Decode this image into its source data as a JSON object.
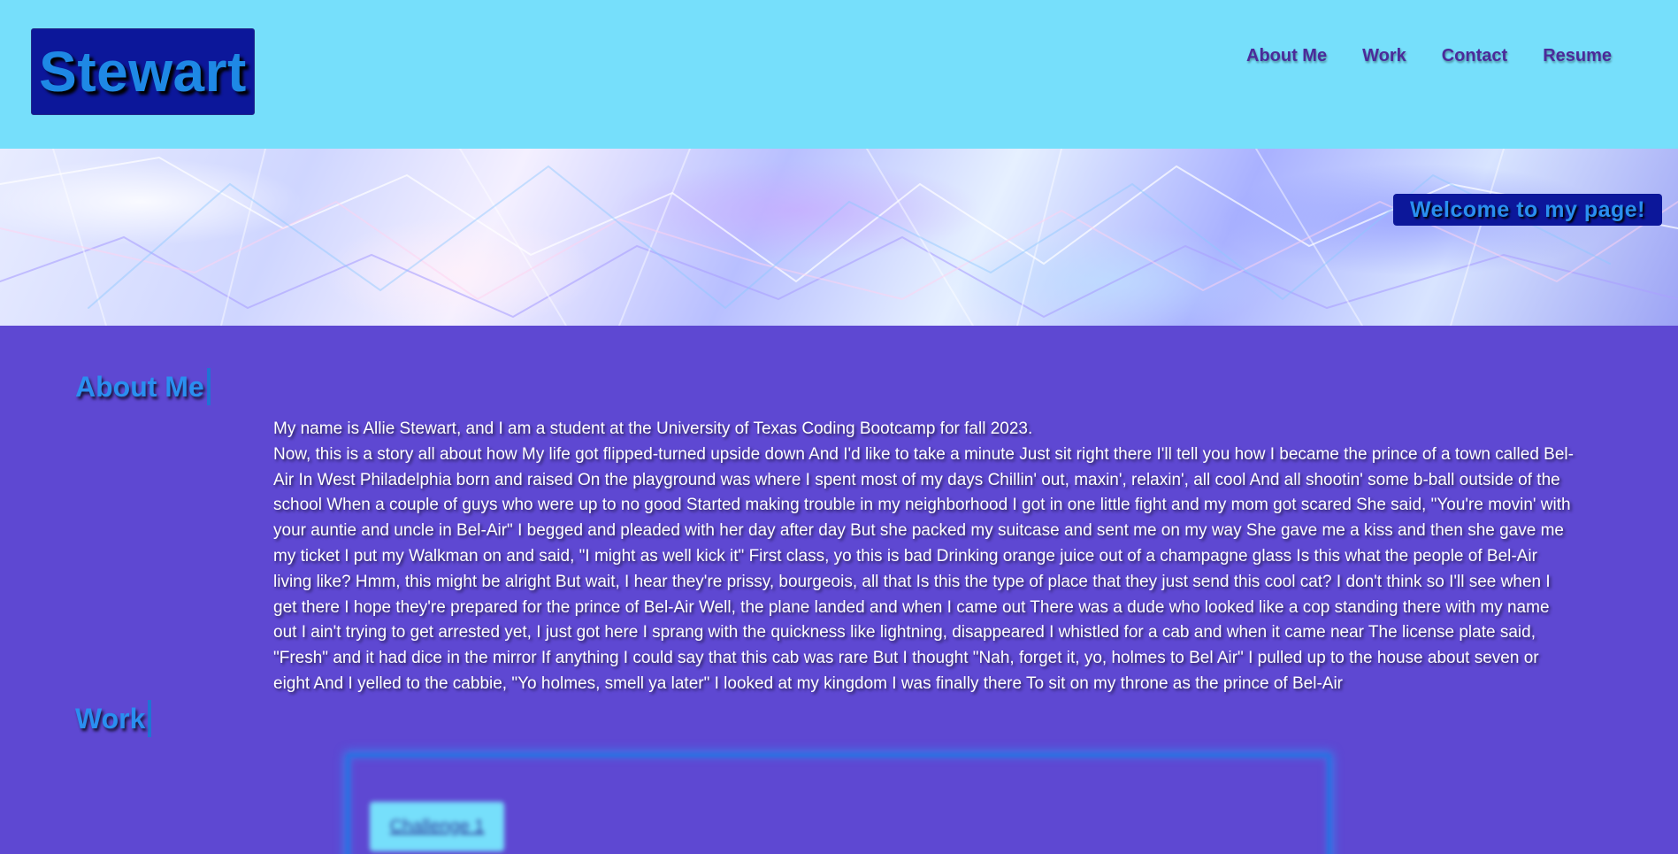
{
  "header": {
    "logo_text": "Stewart",
    "nav": [
      {
        "label": "About Me"
      },
      {
        "label": "Work"
      },
      {
        "label": "Contact"
      },
      {
        "label": "Resume"
      }
    ]
  },
  "hero": {
    "welcome_text": "Welcome to my page!"
  },
  "about": {
    "title": "About Me",
    "intro": "My name is Allie Stewart, and I am a student at the University of Texas Coding Bootcamp for fall 2023.",
    "story": "Now, this is a story all about how My life got flipped-turned upside down And I'd like to take a minute Just sit right there I'll tell you how I became the prince of a town called Bel-Air In West Philadelphia born and raised On the playground was where I spent most of my days Chillin' out, maxin', relaxin', all cool And all shootin' some b-ball outside of the school When a couple of guys who were up to no good Started making trouble in my neighborhood I got in one little fight and my mom got scared She said, \"You're movin' with your auntie and uncle in Bel-Air\" I begged and pleaded with her day after day But she packed my suitcase and sent me on my way She gave me a kiss and then she gave me my ticket I put my Walkman on and said, \"I might as well kick it\" First class, yo this is bad Drinking orange juice out of a champagne glass Is this what the people of Bel-Air living like? Hmm, this might be alright But wait, I hear they're prissy, bourgeois, all that Is this the type of place that they just send this cool cat? I don't think so I'll see when I get there I hope they're prepared for the prince of Bel-Air Well, the plane landed and when I came out There was a dude who looked like a cop standing there with my name out I ain't trying to get arrested yet, I just got here I sprang with the quickness like lightning, disappeared I whistled for a cab and when it came near The license plate said, \"Fresh\" and it had dice in the mirror If anything I could say that this cab was rare But I thought \"Nah, forget it, yo, holmes to Bel Air\" I pulled up to the house about seven or eight And I yelled to the cabbie, \"Yo holmes, smell ya later\" I looked at my kingdom I was finally there To sit on my throne as the prince of Bel-Air"
  },
  "work": {
    "title": "Work",
    "card_button": "Challenge 1"
  },
  "colors": {
    "header_bg": "#76dffb",
    "body_bg": "#5e48d2",
    "logo_bg": "#0c179a",
    "accent_blue": "#2a8ff0",
    "nav_text": "#4b2a9a"
  }
}
